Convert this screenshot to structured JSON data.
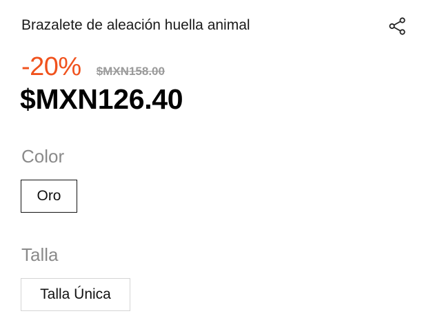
{
  "product": {
    "title": "Brazalete de aleación huella animal",
    "discount": "-20%",
    "original_price": "$MXN158.00",
    "current_price": "$MXN126.40"
  },
  "share": {
    "icon": "share-icon"
  },
  "options": {
    "color_label": "Color",
    "color_value": "Oro",
    "size_label": "Talla",
    "size_value": "Talla Única"
  },
  "colors": {
    "discount": "#f0521d",
    "original_price": "#9a9a9a",
    "label": "#8a8a8a",
    "selected_border": "#111111",
    "unselected_border": "#d4d4d4"
  }
}
